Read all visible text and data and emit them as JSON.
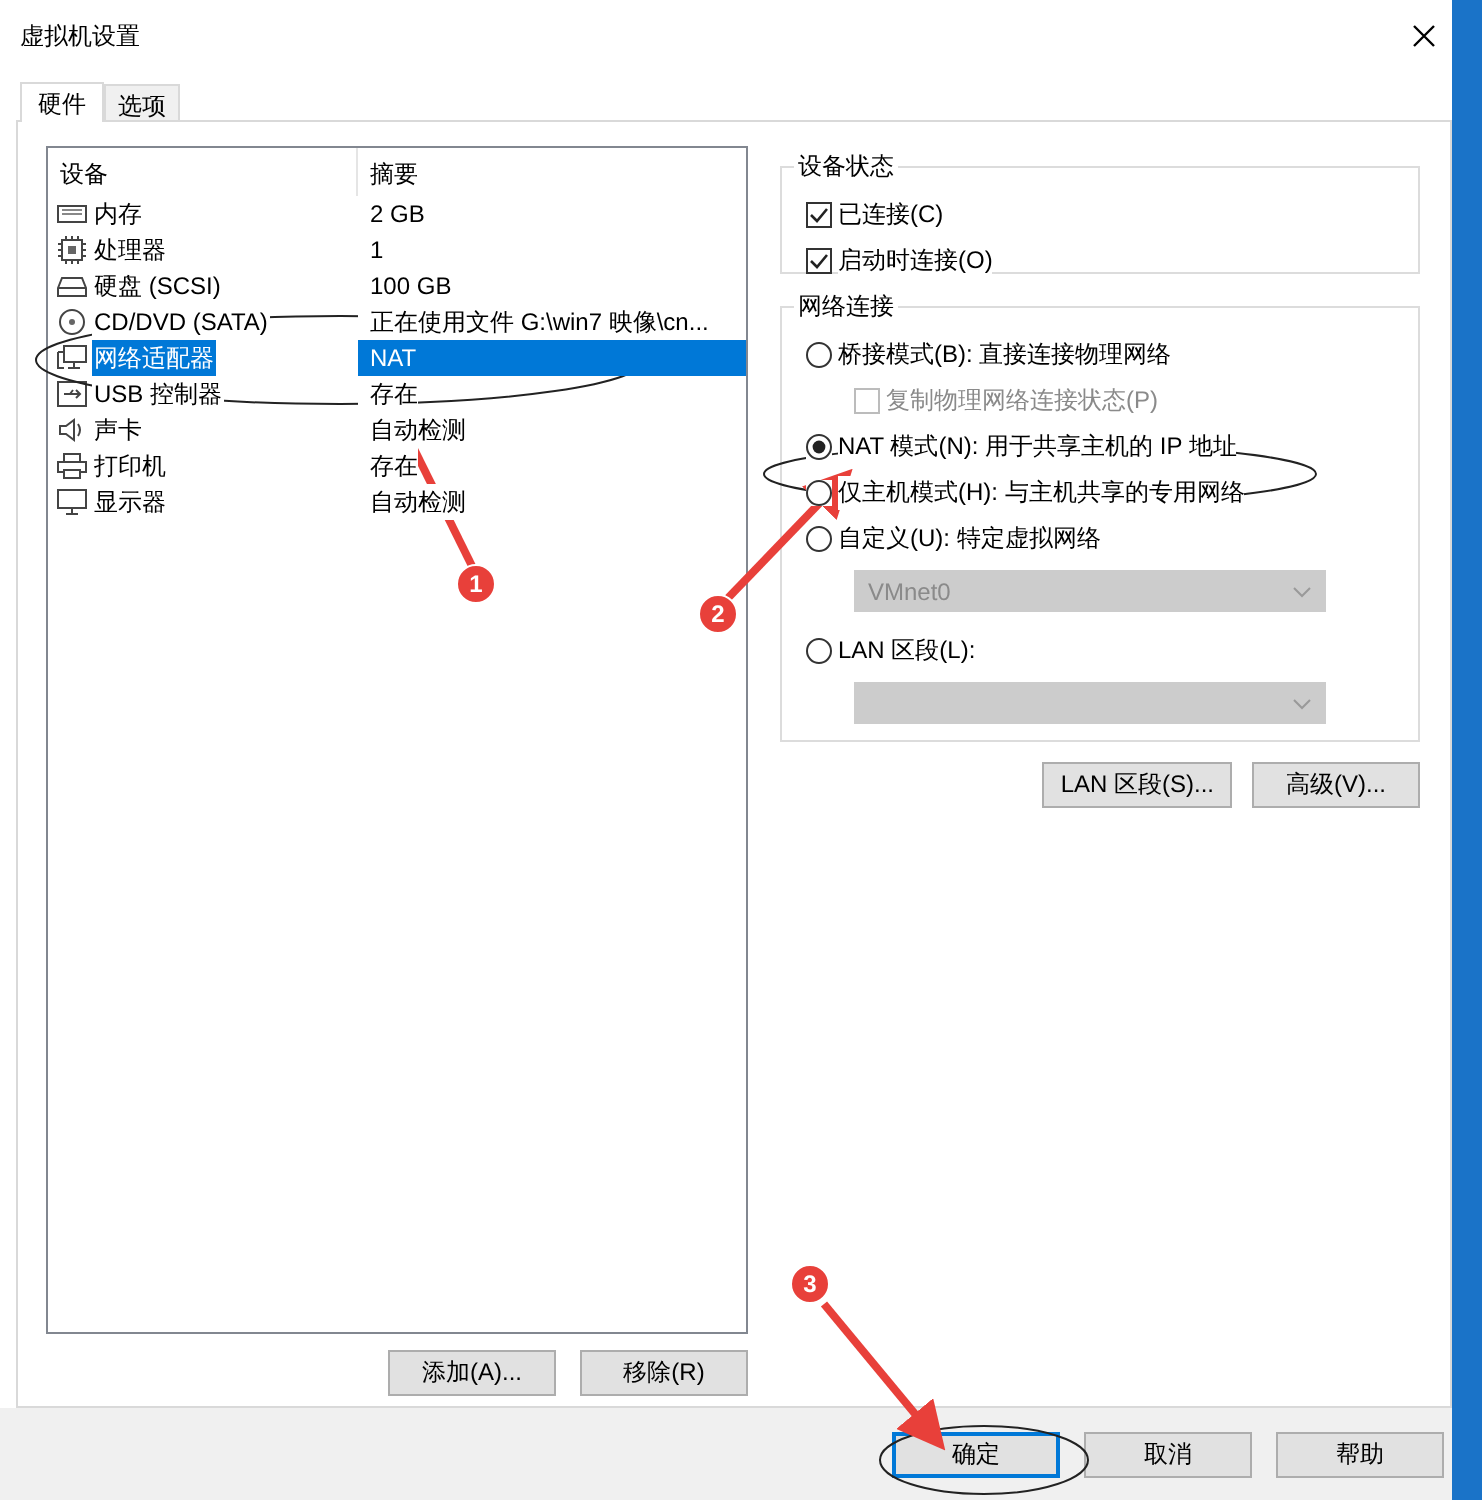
{
  "window": {
    "title": "虚拟机设置"
  },
  "tabs": [
    {
      "label": "硬件",
      "selected": true
    },
    {
      "label": "选项",
      "selected": false
    }
  ],
  "devices": {
    "columns": [
      "设备",
      "摘要"
    ],
    "rows": [
      {
        "kind": "memory",
        "name": "内存",
        "summary": "2 GB",
        "selected": false
      },
      {
        "kind": "cpu",
        "name": "处理器",
        "summary": "1",
        "selected": false
      },
      {
        "kind": "disk",
        "name": "硬盘 (SCSI)",
        "summary": "100 GB",
        "selected": false
      },
      {
        "kind": "cd",
        "name": "CD/DVD (SATA)",
        "summary": "正在使用文件 G:\\win7 映像\\cn...",
        "selected": false
      },
      {
        "kind": "network",
        "name": "网络适配器",
        "summary": "NAT",
        "selected": true
      },
      {
        "kind": "usb",
        "name": "USB 控制器",
        "summary": "存在",
        "selected": false
      },
      {
        "kind": "sound",
        "name": "声卡",
        "summary": "自动检测",
        "selected": false
      },
      {
        "kind": "printer",
        "name": "打印机",
        "summary": "存在",
        "selected": false
      },
      {
        "kind": "display",
        "name": "显示器",
        "summary": "自动检测",
        "selected": false
      }
    ]
  },
  "list_buttons": [
    "添加(A)...",
    "移除(R)"
  ],
  "device_status": {
    "title": "设备状态",
    "options": [
      {
        "label": "已连接(C)",
        "checked": true
      },
      {
        "label": "启动时连接(O)",
        "checked": true
      }
    ]
  },
  "network": {
    "title": "网络连接",
    "options": [
      {
        "kind": "radio",
        "label": "桥接模式(B): 直接连接物理网络",
        "selected": false
      },
      {
        "kind": "checkbox",
        "label": "复制物理网络连接状态(P)",
        "checked": false,
        "disabled": true
      },
      {
        "kind": "radio",
        "label": "NAT 模式(N): 用于共享主机的 IP 地址",
        "selected": true
      },
      {
        "kind": "radio",
        "label": "仅主机模式(H): 与主机共享的专用网络",
        "selected": false
      },
      {
        "kind": "radio",
        "label": "自定义(U): 特定虚拟网络",
        "selected": false
      },
      {
        "kind": "select",
        "value": "VMnet0",
        "disabled": true
      },
      {
        "kind": "radio",
        "label": "LAN 区段(L):",
        "selected": false
      },
      {
        "kind": "select",
        "disabled": true
      }
    ]
  },
  "network_buttons": [
    "LAN 区段(S)...",
    "高级(V)..."
  ],
  "dialog_buttons": [
    {
      "label": "确定",
      "default": true
    },
    {
      "label": "取消",
      "default": false
    },
    {
      "label": "帮助",
      "default": false
    }
  ],
  "annotations": [
    {
      "number": "1"
    },
    {
      "number": "2"
    },
    {
      "number": "3"
    }
  ]
}
